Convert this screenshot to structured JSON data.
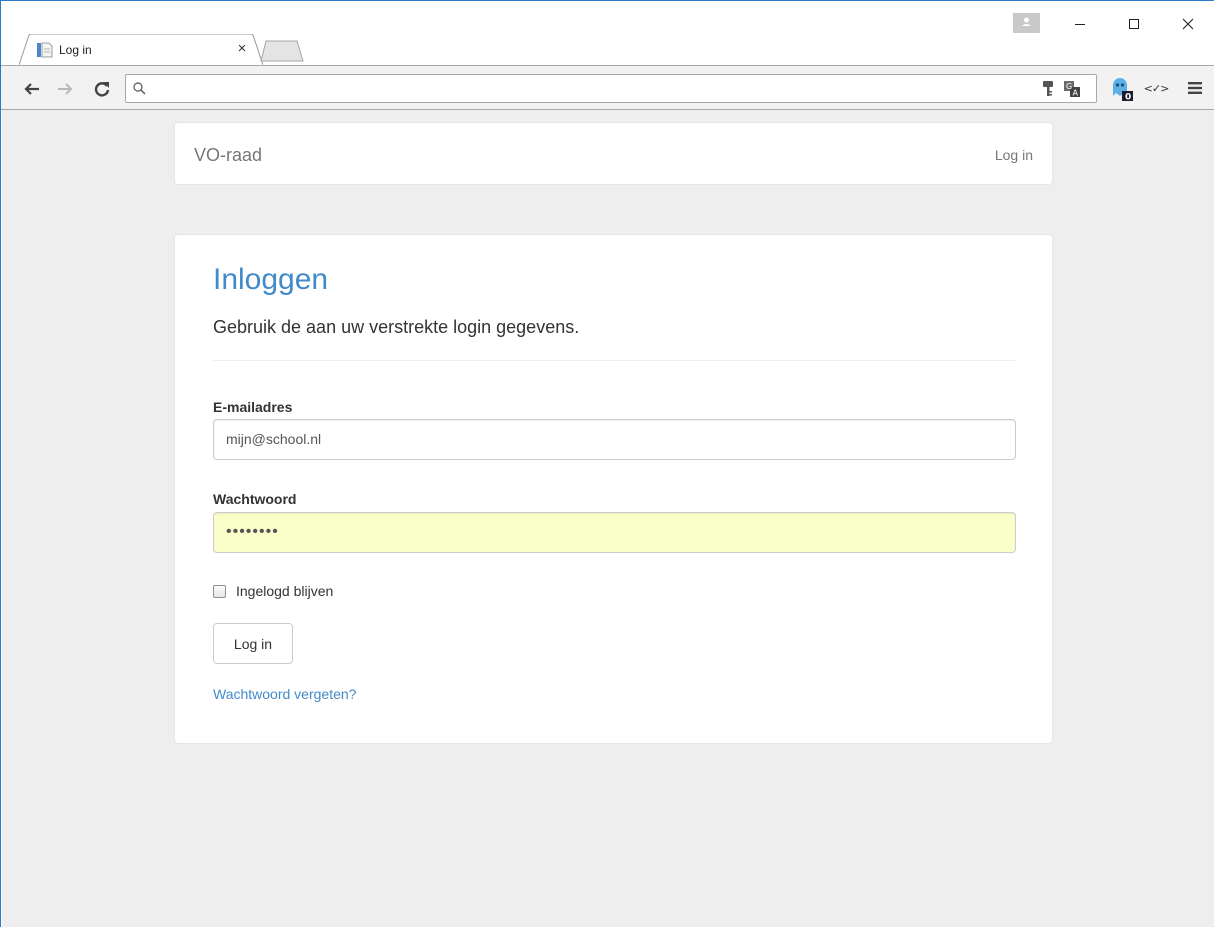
{
  "browser": {
    "tab_title": "Log in",
    "tab_close": "×",
    "address": "",
    "ghostery_count": "0",
    "codeview_label": "<✓>"
  },
  "navbar": {
    "brand": "VO-raad",
    "login_link": "Log in"
  },
  "login": {
    "title": "Inloggen",
    "subtitle": "Gebruik de aan uw verstrekte login gegevens.",
    "email_label": "E-mailadres",
    "email_value": "mijn@school.nl",
    "password_label": "Wachtwoord",
    "password_value": "••••••••",
    "remember_label": "Ingelogd blijven",
    "remember_checked": false,
    "submit_label": "Log in",
    "forgot_link": "Wachtwoord vergeten?"
  },
  "colors": {
    "accent": "#428bca",
    "autofill": "#fafec9",
    "page_bg": "#eeeeee"
  }
}
